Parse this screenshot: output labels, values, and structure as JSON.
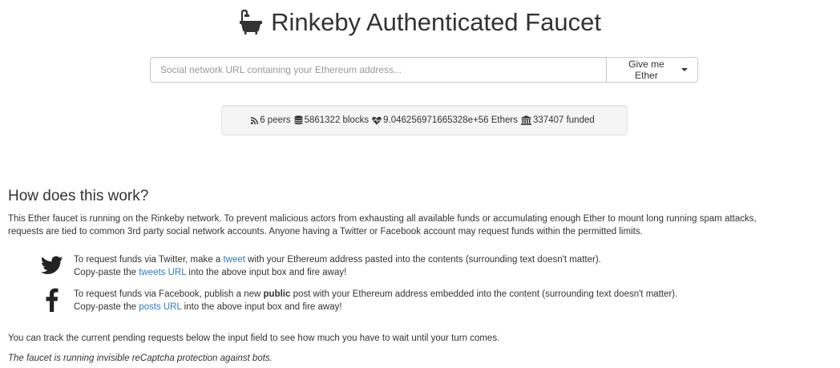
{
  "header": {
    "icon": "bath-icon",
    "title": "Rinkeby Authenticated Faucet"
  },
  "request": {
    "placeholder": "Social network URL containing your Ethereum address...",
    "value": "",
    "button_label": "Give me Ether"
  },
  "stats": {
    "peers": "6 peers",
    "blocks": "5861322 blocks",
    "ethers": "9.046256971665328e+56 Ethers",
    "funded": "337407 funded"
  },
  "how": {
    "title": "How does this work?",
    "intro_line1": "This Ether faucet is running on the Rinkeby network. To prevent malicious actors from exhausting all available funds or accumulating enough Ether to mount long running spam attacks,",
    "intro_line2": "requests are tied to common 3rd party social network accounts. Anyone having a Twitter or Facebook account may request funds within the permitted limits.",
    "twitter": {
      "line1_pre": "To request funds via Twitter, make a ",
      "line1_link": "tweet",
      "line1_post": " with your Ethereum address pasted into the contents (surrounding text doesn't matter).",
      "line2_pre": "Copy-paste the ",
      "line2_link": "tweets URL",
      "line2_post": " into the above input box and fire away!"
    },
    "facebook": {
      "line1_pre": "To request funds via Facebook, publish a new ",
      "line1_bold": "public",
      "line1_post": " post with your Ethereum address embedded into the content (surrounding text doesn't matter).",
      "line2_pre": "Copy-paste the ",
      "line2_link": "posts URL",
      "line2_post": " into the above input box and fire away!"
    },
    "track": "You can track the current pending requests below the input field to see how much you have to wait until your turn comes.",
    "captcha": "The faucet is running invisible reCaptcha protection against bots."
  },
  "colors": {
    "link": "#337ab7",
    "text": "#333333",
    "well_bg": "#f5f5f5"
  }
}
